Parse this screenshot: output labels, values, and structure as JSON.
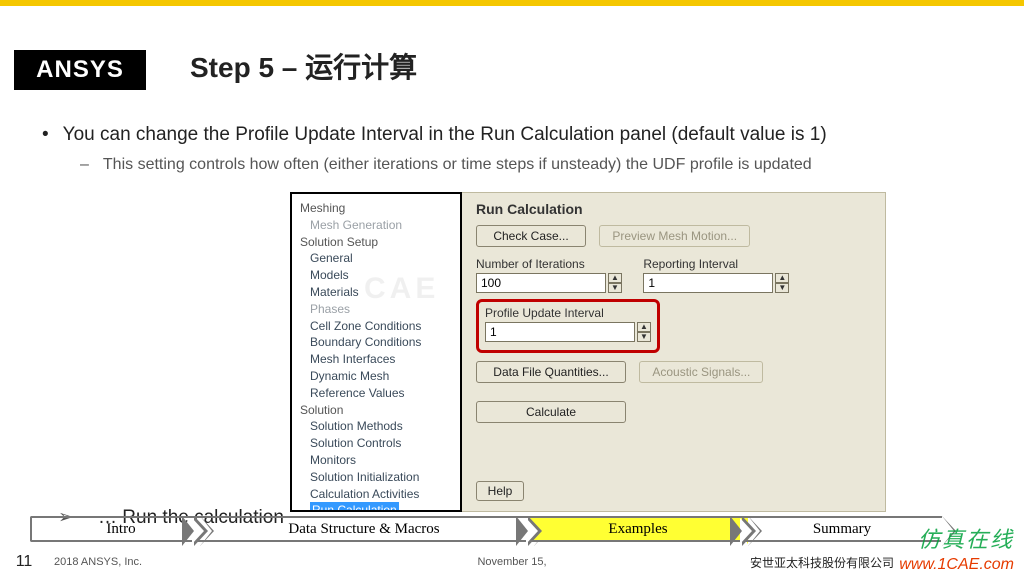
{
  "logo": "ANSYS",
  "title": "Step 5 – 运行计算",
  "bullet_main": "You can change the Profile Update Interval in the Run Calculation panel (default value is 1)",
  "bullet_sub": "This setting controls how often (either iterations or time steps if unsteady) the UDF profile is updated",
  "bullet_last": "… Run the calculation",
  "tree": {
    "meshing": "Meshing",
    "meshgen": "Mesh Generation",
    "setup": "Solution Setup",
    "general": "General",
    "models": "Models",
    "materials": "Materials",
    "phases": "Phases",
    "cellzone": "Cell Zone Conditions",
    "boundary": "Boundary Conditions",
    "meshif": "Mesh Interfaces",
    "dynmesh": "Dynamic Mesh",
    "refvals": "Reference Values",
    "solution": "Solution",
    "methods": "Solution Methods",
    "controls": "Solution Controls",
    "monitors": "Monitors",
    "init": "Solution Initialization",
    "calcact": "Calculation Activities",
    "runcalc": "Run Calculation"
  },
  "panel": {
    "title": "Run Calculation",
    "check_case": "Check Case...",
    "preview": "Preview Mesh Motion...",
    "num_iter_label": "Number of Iterations",
    "num_iter_value": "100",
    "report_label": "Reporting Interval",
    "report_value": "1",
    "profile_label": "Profile Update Interval",
    "profile_value": "1",
    "data_file": "Data File Quantities...",
    "acoustic": "Acoustic Signals...",
    "calculate": "Calculate",
    "help": "Help"
  },
  "nav": {
    "intro": "Intro",
    "data": "Data Structure & Macros",
    "examples": "Examples",
    "summary": "Summary"
  },
  "footer": {
    "page": "11",
    "copyright": "2018   ANSYS, Inc.",
    "date": "November 15,",
    "cn": "安世亚太科技股份有限公司"
  },
  "watermark1": "仿真在线",
  "watermark2": "www.1CAE.com",
  "faint_wm": "CAE"
}
